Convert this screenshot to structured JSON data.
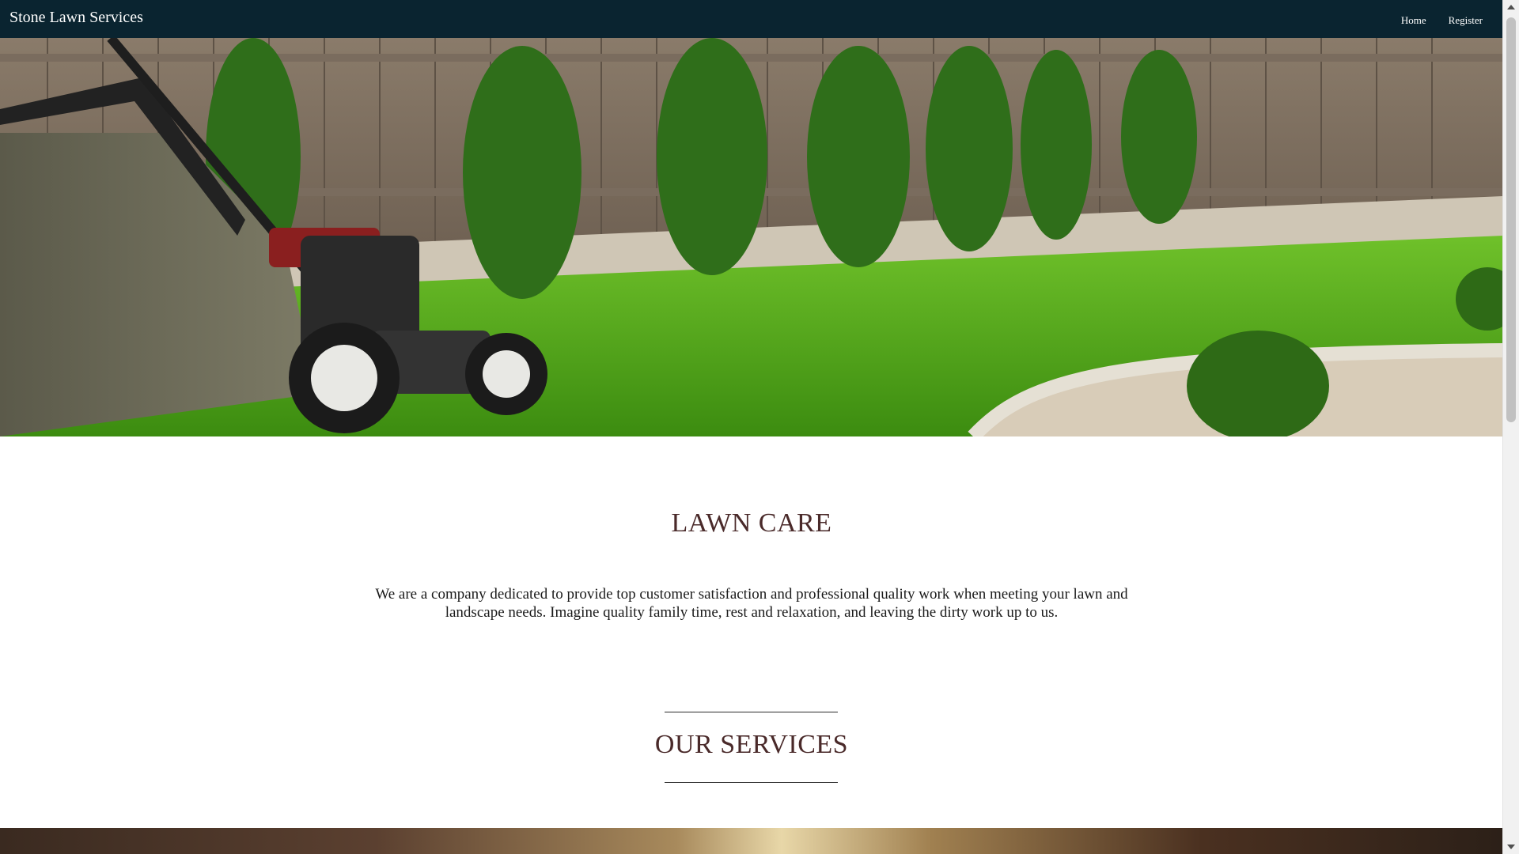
{
  "nav": {
    "brand": "Stone Lawn Services",
    "links": [
      {
        "label": "Home"
      },
      {
        "label": "Register"
      }
    ]
  },
  "hero": {
    "image": "lawn-mower-backyard-photo"
  },
  "main": {
    "lawn_care_title": "LAWN CARE",
    "intro_text": "We are a company dedicated to provide top customer satisfaction and professional quality work when meeting your lawn and landscape needs. Imagine quality family time, rest and relaxation, and leaving the dirty work up to us.",
    "services_title": "OUR SERVICES"
  },
  "colors": {
    "navbar_bg": "#0a2430",
    "heading_color": "#4a2a2a",
    "text_color": "#1a1a1a"
  }
}
